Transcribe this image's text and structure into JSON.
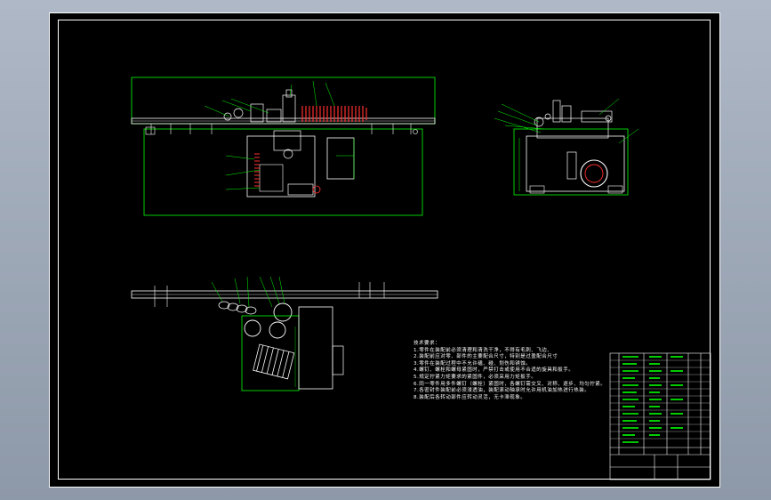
{
  "notes": {
    "title": "技术要求：",
    "lines": [
      "1.零件在装配前必须清理和清洗干净，不得有毛刺、飞边、",
      "2.装配前应对零、部件的主要配合尺寸，特别是过盈配合尺寸",
      "3.零件在装配过程中不允许磕、碰、划伤和锈蚀。",
      "4.螺钉、螺栓和螺母紧固时，严禁打击或使用不合适的旋具和扳手。",
      "5.规定拧紧力矩要求的紧固件，必须采用力矩扳手。",
      "6.同一零件用多件螺钉（螺栓）紧固时，各螺钉需交叉、对称、逐步、均匀拧紧。",
      "7.各密封件装配前必须浸透油，装配滚动轴承时允许用机油加热进行热装。",
      "8.装配后各转动部件应转动灵活，无卡滞现象。"
    ]
  },
  "colors": {
    "background": "#9ca6b5",
    "sheet": "#000000",
    "frame": "#ffffff",
    "outline": "#00ff00",
    "parts": "#ffffff",
    "accent": "#ff0000",
    "leader": "#00ff00",
    "dimension": "#ffff00"
  }
}
